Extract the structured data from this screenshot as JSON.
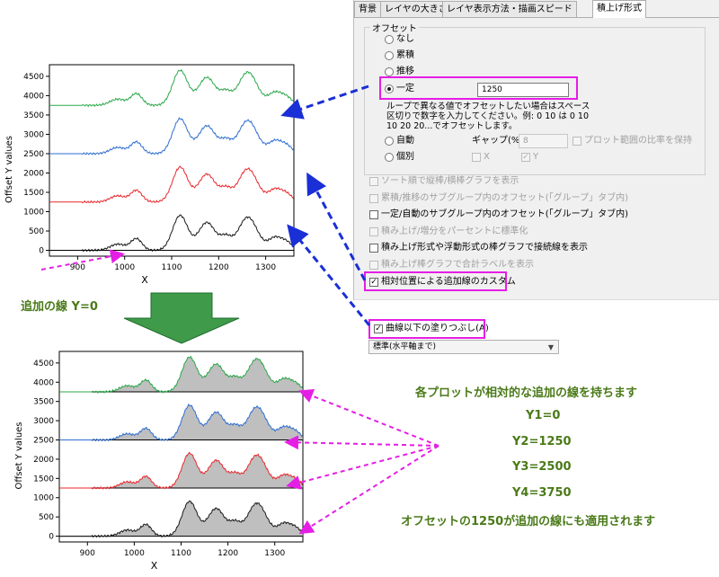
{
  "dialog": {
    "tabs": [
      "背景",
      "レイヤの大きさ",
      "レイヤ表示方法・描画スピード",
      "積上げ形式"
    ],
    "offset_group_title": "オフセット",
    "offset_options": [
      "なし",
      "累積",
      "推移",
      "一定"
    ],
    "constant_value": "1250",
    "note_line1": "ループで異なる値でオフセットしたい場合はスペース",
    "note_line2": "区切りで数字を入力してください。例: 0 10 は 0 10",
    "note_line3": "10 20 20...でオフセットします。",
    "auto_label": "自動",
    "gap_label": "ギャップ(%)",
    "gap_value": "8",
    "keep_ratio_label": "プロット範囲の比率を保持",
    "individual_label": "個別",
    "x_label": "X",
    "y_label": "Y",
    "options": [
      {
        "label": "ソート順で縦棒/横棒グラフを表示",
        "enabled": false,
        "checked": false
      },
      {
        "label": "累積/推移のサブグループ内のオフセット(「グループ」タブ内)",
        "enabled": false,
        "checked": false
      },
      {
        "label": "一定/自動のサブグループ内のオフセット(「グループ」タブ内)",
        "enabled": true,
        "checked": false
      },
      {
        "label": "積み上げ/増分をパーセントに標準化",
        "enabled": false,
        "checked": false
      },
      {
        "label": "積み上げ形式や浮動形式の棒グラフで接続線を表示",
        "enabled": true,
        "checked": false
      },
      {
        "label": "積み上げ棒グラフで合計ラベルを表示",
        "enabled": false,
        "checked": false
      },
      {
        "label": "相対位置による追加線のカスタム",
        "enabled": true,
        "checked": true
      }
    ],
    "fill_label": "曲線以下の塗りつぶし(A)",
    "fill_dropdown": "標準(水平軸まで)"
  },
  "annotations": {
    "extra_line_label": "追加の線 Y=0",
    "right_lines": [
      "各プロットが相対的な追加の線を持ちます",
      "Y1=0",
      "Y2=1250",
      "Y3=2500",
      "Y4=3750",
      "オフセットの1250が追加の線にも適用されます"
    ]
  },
  "chart_data": [
    {
      "type": "line",
      "ylabel": "Offset Y values",
      "xlabel": "X",
      "xticks": [
        900,
        1000,
        1100,
        1200,
        1300
      ],
      "yticks": [
        0,
        500,
        1000,
        1500,
        2000,
        2500,
        3000,
        3500,
        4000,
        4500
      ],
      "xlim": [
        840,
        1360
      ],
      "ylim": [
        -150,
        4800
      ],
      "offset": 1250,
      "fill": false,
      "series": [
        {
          "color": "#1a1a1a"
        },
        {
          "color": "#e8282d"
        },
        {
          "color": "#2f6fd0"
        },
        {
          "color": "#2aa84a"
        }
      ]
    },
    {
      "type": "area",
      "ylabel": "Offset Y values",
      "xlabel": "X",
      "xticks": [
        900,
        1000,
        1100,
        1200,
        1300
      ],
      "yticks": [
        0,
        500,
        1000,
        1500,
        2000,
        2500,
        3000,
        3500,
        4000,
        4500
      ],
      "xlim": [
        840,
        1360
      ],
      "ylim": [
        -150,
        4800
      ],
      "offset": 1250,
      "fill": true,
      "fill_color": "#bfbfbf",
      "series": [
        {
          "color": "#1a1a1a"
        },
        {
          "color": "#e8282d"
        },
        {
          "color": "#2f6fd0"
        },
        {
          "color": "#2aa84a"
        }
      ]
    }
  ]
}
